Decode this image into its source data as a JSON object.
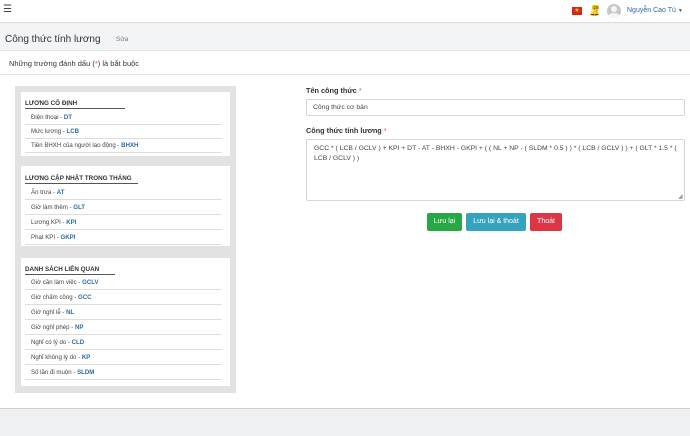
{
  "topbar": {
    "flag_label": "★",
    "notification_count": "18",
    "username": "Nguyễn Cao Tú",
    "accent": "#2c6ca3"
  },
  "header": {
    "title": "Công thức tính lương",
    "subtitle": "Sửa"
  },
  "form_note": {
    "prefix": "Những trường đánh dấu (",
    "star": "*",
    "suffix": ") là bắt buộc"
  },
  "sidebar": {
    "sections": [
      {
        "title": "LƯƠNG CỐ ĐỊNH",
        "items": [
          {
            "label": "Điện thoại - ",
            "code": "DT"
          },
          {
            "label": "Mức lương - ",
            "code": "LCB"
          },
          {
            "label": "Tiền BHXH của người lao động - ",
            "code": "BHXH"
          }
        ]
      },
      {
        "title": "LƯƠNG CẬP NHẬT TRONG THÁNG",
        "items": [
          {
            "label": "Ăn trưa - ",
            "code": "AT"
          },
          {
            "label": "Giờ làm thêm - ",
            "code": "GLT"
          },
          {
            "label": "Lương KPI - ",
            "code": "KPI"
          },
          {
            "label": "Phạt KPI - ",
            "code": "GKPI"
          }
        ]
      },
      {
        "title": "DANH SÁCH LIÊN QUAN",
        "items": [
          {
            "label": "Giờ cần làm việc - ",
            "code": "GCLV"
          },
          {
            "label": "Giờ chấm công - ",
            "code": "GCC"
          },
          {
            "label": "Giờ nghỉ lễ - ",
            "code": "NL"
          },
          {
            "label": "Giờ nghỉ phép - ",
            "code": "NP"
          },
          {
            "label": "Nghỉ có lý do - ",
            "code": "CLD"
          },
          {
            "label": "Nghỉ không lý do - ",
            "code": "KP"
          },
          {
            "label": "Số lần đi muộn - ",
            "code": "SLDM"
          }
        ]
      }
    ]
  },
  "form": {
    "name_label": "Tên công thức",
    "name_value": "Công thức cơ bản",
    "formula_label": "Công thức tính lương",
    "formula_value": "GCC * ( LCB / GCLV ) + KPI + DT - AT - BHXH - GKPI + ( ( NL + NP - ( SLDM * 0.5 ) ) * ( LCB / GCLV ) ) + ( GLT * 1.5 * ( LCB / GCLV ) )",
    "required_star": "*"
  },
  "actions": {
    "save": "Lưu lại",
    "save_exit": "Lưu lại & thoát",
    "exit": "Thoát",
    "colors": {
      "save": "#28a745",
      "save_exit": "#35a3be",
      "exit": "#dc3545"
    }
  }
}
